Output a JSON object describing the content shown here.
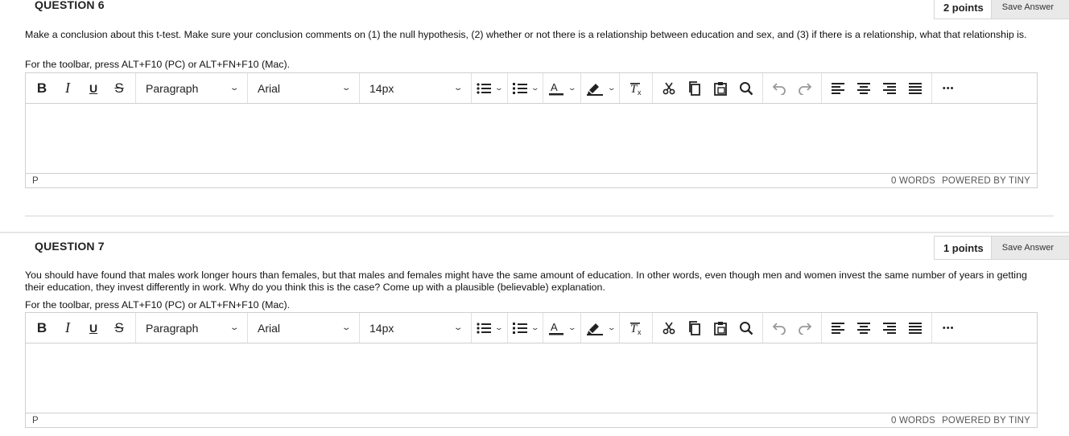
{
  "questions": [
    {
      "title": "QUESTION 6",
      "points": "2 points",
      "save_label": "Save Answer",
      "prompt": "Make a conclusion about this t-test. Make sure your conclusion comments on (1) the null hypothesis, (2) whether or not there is a relationship between education and sex, and (3) if there is a relationship, what that relationship is.",
      "toolbar_hint": "For the toolbar, press ALT+F10 (PC) or ALT+FN+F10 (Mac).",
      "editor": {
        "format_buttons": [
          "B",
          "I",
          "U",
          "S"
        ],
        "paragraph": "Paragraph",
        "font": "Arial",
        "size": "14px",
        "status_path": "P",
        "word_count": "0 WORDS",
        "powered_by": "POWERED BY TINY"
      }
    },
    {
      "title": "QUESTION 7",
      "points": "1 points",
      "save_label": "Save Answer",
      "prompt": "You should have found that males work longer hours than females, but that males and females might have the same amount of education. In other words, even though men and women invest the same number of years in getting their education, they invest differently in work. Why do you think this is the case? Come up with a plausible (believable) explanation.",
      "toolbar_hint": "For the toolbar, press ALT+F10 (PC) or ALT+FN+F10 (Mac).",
      "editor": {
        "format_buttons": [
          "B",
          "I",
          "U",
          "S"
        ],
        "paragraph": "Paragraph",
        "font": "Arial",
        "size": "14px",
        "status_path": "P",
        "word_count": "0 WORDS",
        "powered_by": "POWERED BY TINY"
      }
    }
  ],
  "icons": {
    "chevron": "chevron-down-icon",
    "more": "•••"
  }
}
